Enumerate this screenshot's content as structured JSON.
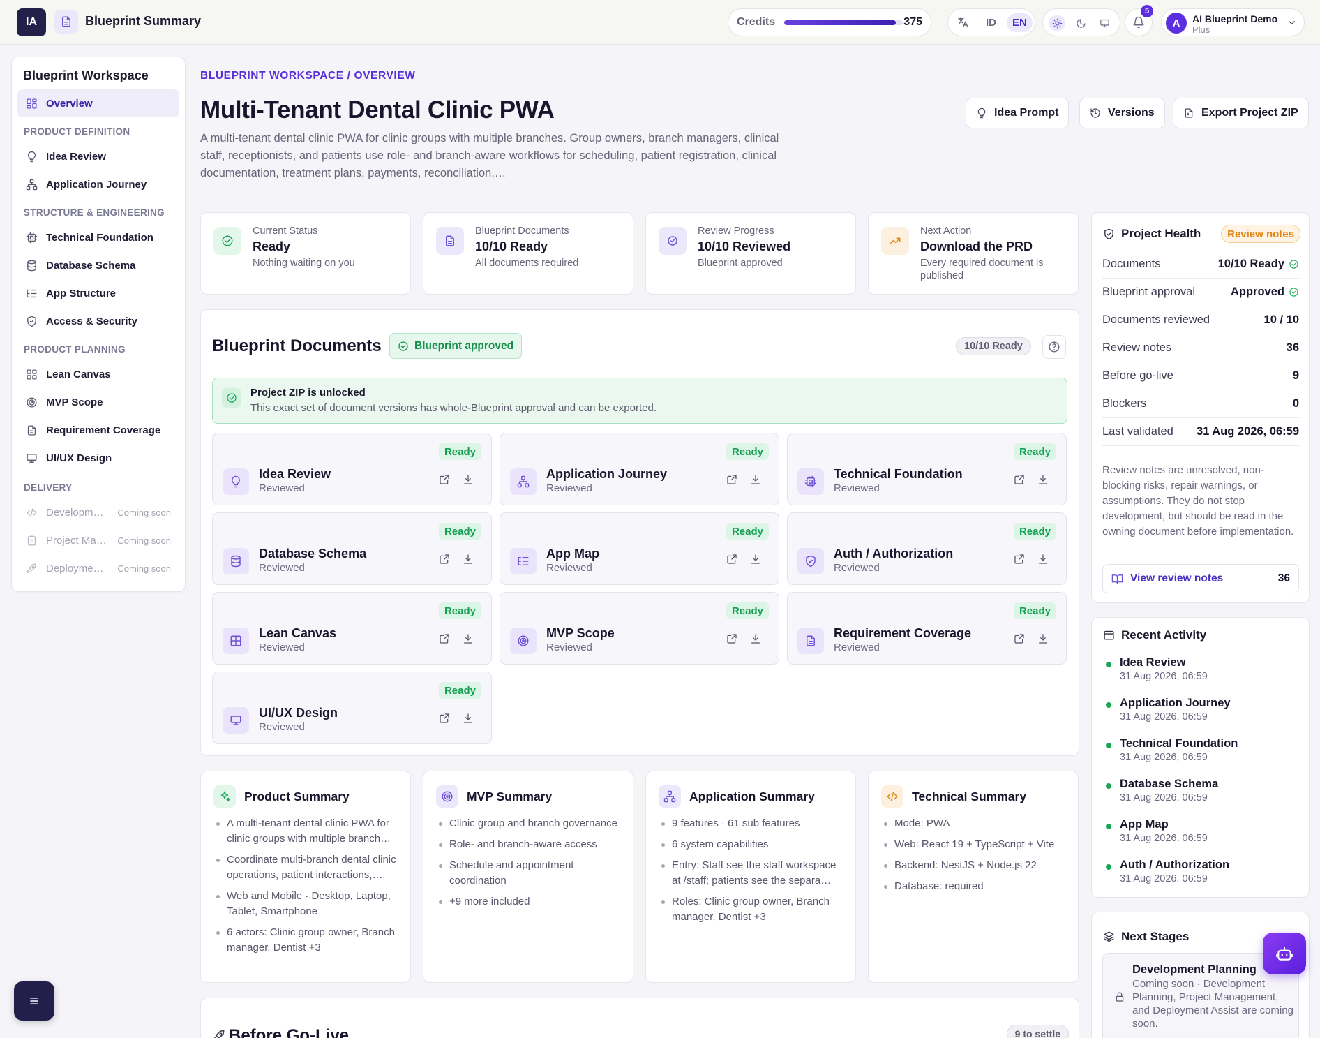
{
  "topbar": {
    "logo_text": "IA",
    "app_title": "Blueprint Summary",
    "credits_label": "Credits",
    "credits_value": "375",
    "credits_fraction": 0.94,
    "lang_id": "ID",
    "lang_en": "EN",
    "notifications": "5",
    "avatar_initial": "A",
    "user_name": "AI Blueprint Demo",
    "user_plan": "Plus"
  },
  "sidebar": {
    "title": "Blueprint Workspace",
    "overview": "Overview",
    "sec_product_definition": "PRODUCT DEFINITION",
    "idea_review": "Idea Review",
    "application_journey": "Application Journey",
    "sec_structure": "STRUCTURE & ENGINEERING",
    "technical_foundation": "Technical Foundation",
    "database_schema": "Database Schema",
    "app_structure": "App Structure",
    "access_security": "Access & Security",
    "sec_planning": "PRODUCT PLANNING",
    "lean_canvas": "Lean Canvas",
    "mvp_scope": "MVP Scope",
    "requirement_coverage": "Requirement Coverage",
    "uiux_design": "UI/UX Design",
    "sec_delivery": "DELIVERY",
    "development": "Developm…",
    "project_management": "Project Ma…",
    "deployment": "Deployme…",
    "coming_soon": "Coming soon"
  },
  "header": {
    "breadcrumb": "BLUEPRINT WORKSPACE / OVERVIEW",
    "title": "Multi-Tenant Dental Clinic PWA",
    "description": "A multi-tenant dental clinic PWA for clinic groups with multiple branches. Group owners, branch managers, clinical staff, receptionists, and patients use role- and branch-aware workflows for scheduling, patient registration, clinical documentation, treatment plans, payments, reconciliation,…",
    "btn_idea_prompt": "Idea Prompt",
    "btn_versions": "Versions",
    "btn_export": "Export Project ZIP"
  },
  "status_cards": [
    {
      "label": "Current Status",
      "value": "Ready",
      "sub": "Nothing waiting on you"
    },
    {
      "label": "Blueprint Documents",
      "value": "10/10 Ready",
      "sub": "All documents required"
    },
    {
      "label": "Review Progress",
      "value": "10/10 Reviewed",
      "sub": "Blueprint approved"
    },
    {
      "label": "Next Action",
      "value": "Download the PRD",
      "sub": "Every required document is published"
    }
  ],
  "documents": {
    "title": "Blueprint Documents",
    "approved_badge": "Blueprint approved",
    "ready_count": "10/10 Ready",
    "unlock_title": "Project ZIP is unlocked",
    "unlock_desc": "This exact set of document versions has whole-Blueprint approval and can be exported.",
    "ready_label": "Ready",
    "reviewed_label": "Reviewed",
    "items": [
      {
        "name": "Idea Review",
        "icon": "lightbulb-icon"
      },
      {
        "name": "Application Journey",
        "icon": "sitemap-icon"
      },
      {
        "name": "Technical Foundation",
        "icon": "cpu-icon"
      },
      {
        "name": "Database Schema",
        "icon": "database-icon"
      },
      {
        "name": "App Map",
        "icon": "list-tree-icon"
      },
      {
        "name": "Auth / Authorization",
        "icon": "shield-check-icon"
      },
      {
        "name": "Lean Canvas",
        "icon": "grid-icon"
      },
      {
        "name": "MVP Scope",
        "icon": "target-icon"
      },
      {
        "name": "Requirement Coverage",
        "icon": "document-icon"
      },
      {
        "name": "UI/UX Design",
        "icon": "monitor-icon"
      }
    ]
  },
  "summaries": [
    {
      "title": "Product Summary",
      "items": [
        "A multi-tenant dental clinic PWA for clinic groups with multiple branch…",
        "Coordinate multi-branch dental clinic operations, patient interactions,…",
        "Web and Mobile · Desktop, Laptop, Tablet, Smartphone",
        "6 actors: Clinic group owner, Branch manager, Dentist +3"
      ]
    },
    {
      "title": "MVP Summary",
      "items": [
        "Clinic group and branch governance",
        "Role- and branch-aware access",
        "Schedule and appointment coordination",
        "+9 more included"
      ]
    },
    {
      "title": "Application Summary",
      "items": [
        "9 features · 61 sub features",
        "6 system capabilities",
        "Entry: Staff see the staff workspace at /staff; patients see the separa…",
        "Roles: Clinic group owner, Branch manager, Dentist +3"
      ]
    },
    {
      "title": "Technical Summary",
      "items": [
        "Mode: PWA",
        "Web: React 19 + TypeScript + Vite",
        "Backend: NestJS + Node.js 22",
        "Database: required"
      ]
    }
  ],
  "golive": {
    "title": "Before Go-Live",
    "settle": "9 to settle"
  },
  "health": {
    "title": "Project Health",
    "badge": "Review notes",
    "rows": [
      {
        "label": "Documents",
        "value": "10/10 Ready"
      },
      {
        "label": "Blueprint approval",
        "value": "Approved"
      },
      {
        "label": "Documents reviewed",
        "value": "10 / 10"
      },
      {
        "label": "Review notes",
        "value": "36"
      },
      {
        "label": "Before go-live",
        "value": "9"
      },
      {
        "label": "Blockers",
        "value": "0"
      },
      {
        "label": "Last validated",
        "value": "31 Aug 2026, 06:59"
      }
    ],
    "note": "Review notes are unresolved, non-blocking risks, repair warnings, or assumptions. They do not stop development, but should be read in the owning document before implementation.",
    "view_btn": "View review notes",
    "view_count": "36"
  },
  "activity": {
    "title": "Recent Activity",
    "items": [
      {
        "name": "Idea Review",
        "date": "31 Aug 2026, 06:59"
      },
      {
        "name": "Application Journey",
        "date": "31 Aug 2026, 06:59"
      },
      {
        "name": "Technical Foundation",
        "date": "31 Aug 2026, 06:59"
      },
      {
        "name": "Database Schema",
        "date": "31 Aug 2026, 06:59"
      },
      {
        "name": "App Map",
        "date": "31 Aug 2026, 06:59"
      },
      {
        "name": "Auth / Authorization",
        "date": "31 Aug 2026, 06:59"
      }
    ]
  },
  "stages": {
    "title": "Next Stages",
    "name": "Development Planning",
    "desc": "Coming soon · Development Planning, Project Management, and Deployment Assist are coming soon."
  },
  "colors": {
    "accent": "#5b2ee0",
    "success": "#15a053",
    "warning": "#e08412"
  }
}
